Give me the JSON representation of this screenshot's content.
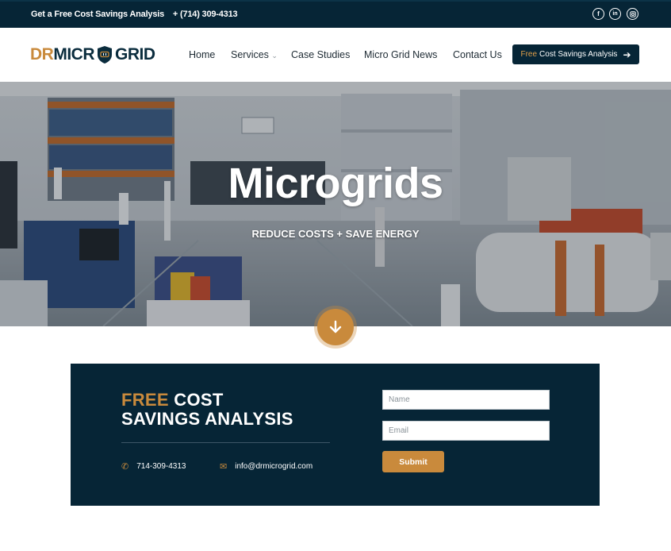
{
  "topbar": {
    "promo": "Get a Free Cost Savings Analysis",
    "phone": "+ (714) 309-4313",
    "social": [
      "f",
      "in",
      "ig"
    ],
    "social_icons": [
      "facebook-icon",
      "linkedin-icon",
      "instagram-icon"
    ]
  },
  "logo": {
    "part1": "DR",
    "part2": "MICR",
    "part3": "GRID"
  },
  "nav": {
    "home": "Home",
    "services": "Services",
    "case_studies": "Case Studies",
    "news": "Micro Grid News",
    "contact": "Contact Us"
  },
  "cta": {
    "free": "Free",
    "rest": "Cost Savings Analysis",
    "arrow": "➔"
  },
  "hero": {
    "title": "Microgrids",
    "subtitle": "REDUCE COSTS + SAVE ENERGY"
  },
  "panel": {
    "title_free": "FREE",
    "title_cost": " COST",
    "title_line2": "SAVINGS ANALYSIS",
    "phone": "714-309-4313",
    "email": "info@drmicrogrid.com"
  },
  "form": {
    "name_placeholder": "Name",
    "email_placeholder": "Email",
    "submit_label": "Submit"
  },
  "colors": {
    "navy": "#062536",
    "gold": "#c98a3c",
    "white": "#ffffff"
  }
}
